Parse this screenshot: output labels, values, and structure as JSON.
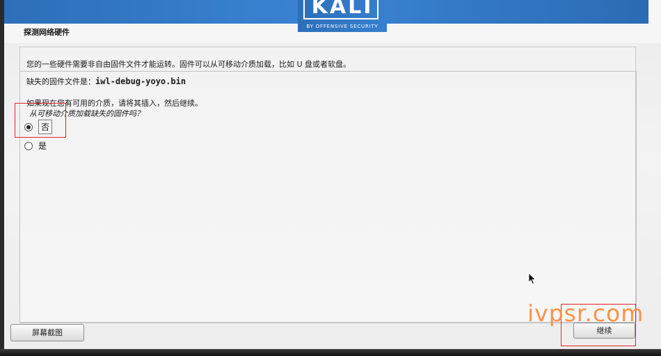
{
  "header": {
    "logo_text": "KALI",
    "logo_subtitle": "BY OFFENSIVE SECURITY",
    "brand_color": "#3479c6"
  },
  "step": {
    "title": "探测网络硬件"
  },
  "message": {
    "line1": "您的一些硬件需要非自由固件文件才能运转。固件可以从可移动介质加载，比如 U 盘或者软盘。",
    "missing_prefix": "缺失的固件文件是：",
    "missing_file": "iwl-debug-yoyo.bin",
    "line3": "如果现在您有可用的介质，请将其插入，然后继续。"
  },
  "question": {
    "text": "从可移动介质加载缺失的固件吗？",
    "options": [
      {
        "label": "否",
        "selected": true
      },
      {
        "label": "是",
        "selected": false
      }
    ]
  },
  "buttons": {
    "screenshot_label": "屏幕截图",
    "continue_label": "继续"
  },
  "watermark": {
    "text": "ivpsr.com",
    "color": "#ff8b3a"
  },
  "annotation_color": "#e0242c",
  "icons": {
    "cursor": "mouse-pointer-icon",
    "radio_selected": "radio-selected-icon",
    "radio_unselected": "radio-unselected-icon"
  }
}
